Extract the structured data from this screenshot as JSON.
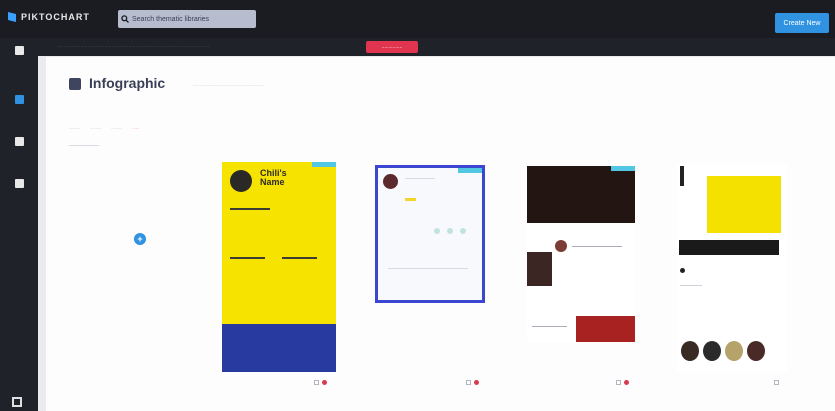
{
  "app": {
    "logo": "PIKTOCHART"
  },
  "search": {
    "placeholder": "Search thematic libraries"
  },
  "header": {
    "create_label": "Create New"
  },
  "notice": {
    "text": "............................................................................................................",
    "button": "..............."
  },
  "sidebar": {
    "items": [
      {
        "label": ""
      },
      {
        "label": ""
      },
      {
        "label": ""
      },
      {
        "label": ""
      }
    ]
  },
  "page": {
    "title": "Infographic",
    "subtitle": "................................................................"
  },
  "filters": [
    "..........",
    "..........",
    "..........",
    "......"
  ],
  "blank_card": {
    "label": ""
  },
  "templates": [
    {
      "caption": "",
      "name_lines": [
        "Chili's",
        "Name"
      ]
    },
    {
      "caption": ""
    },
    {
      "caption": ""
    },
    {
      "caption": ""
    }
  ],
  "blank_caption": "",
  "colors": {
    "accent": "#2f93e2",
    "notice": "#e0344f",
    "yellow": "#f6e300",
    "selection": "#3b46d1"
  }
}
